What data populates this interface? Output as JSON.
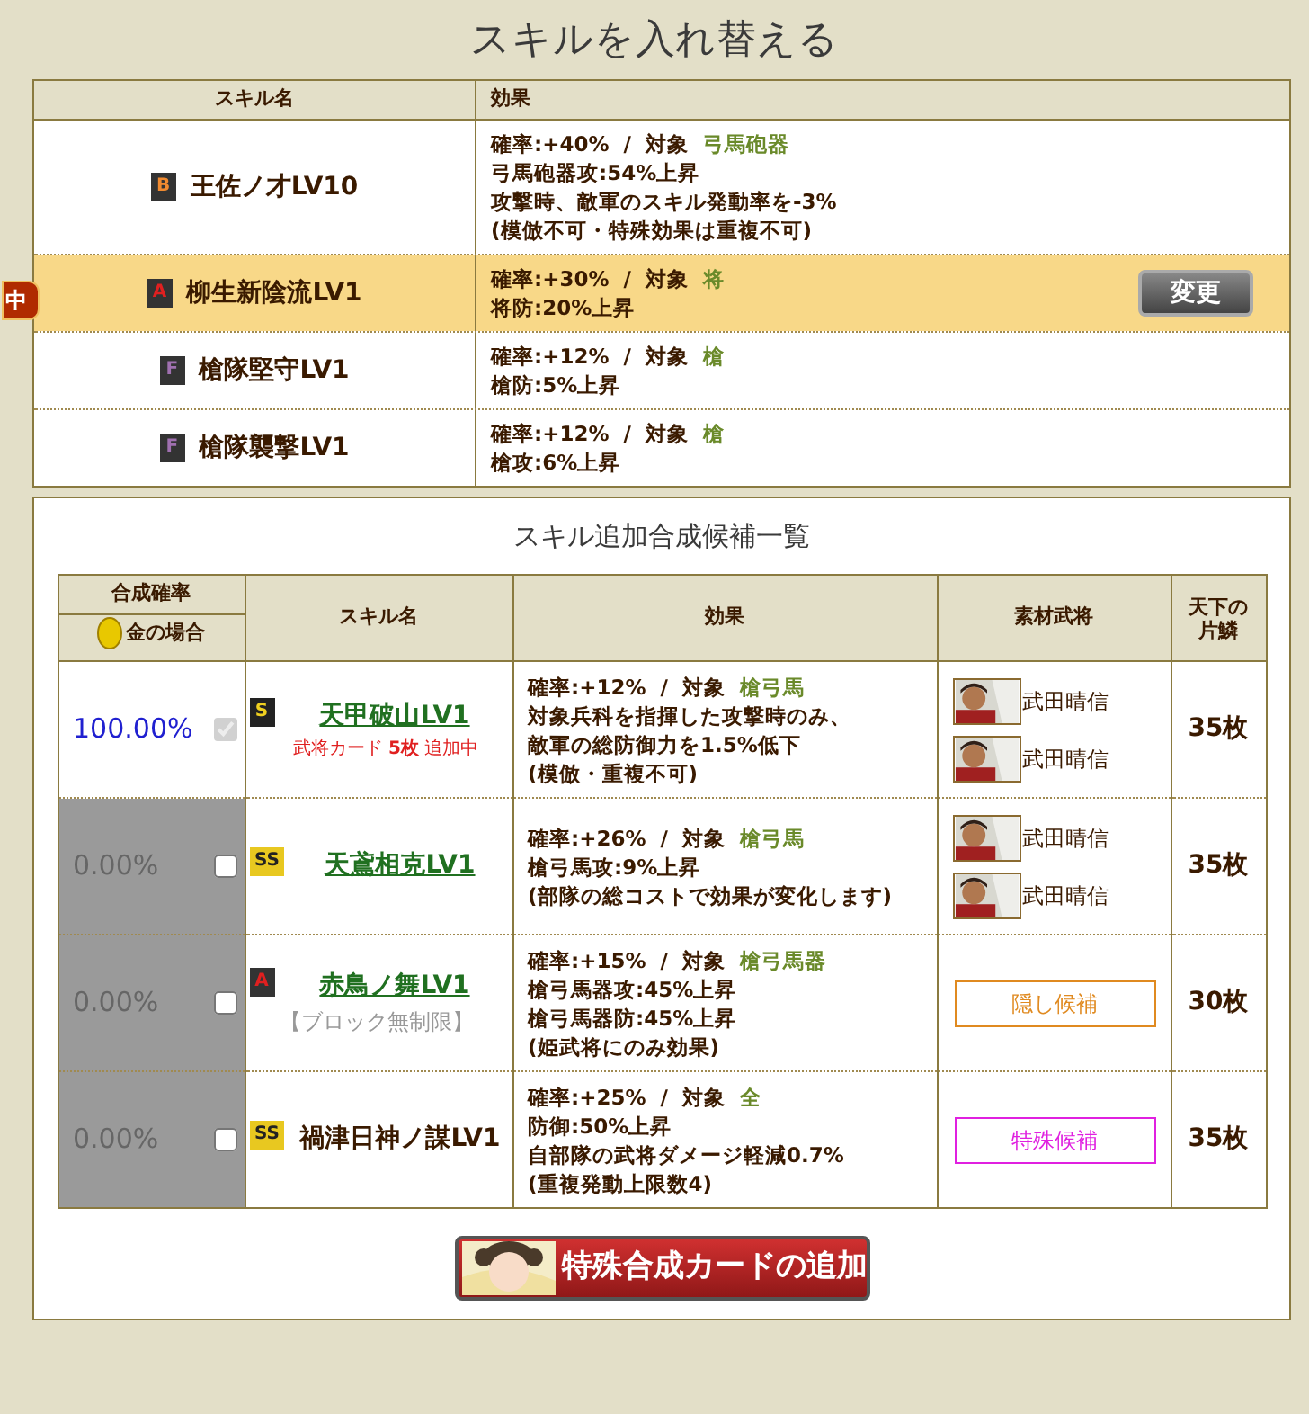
{
  "title": "スキルを入れ替える",
  "current": {
    "columns": [
      "スキル名",
      "効果"
    ],
    "tag": "中",
    "change_button": "変更",
    "rows": [
      {
        "rank": "B",
        "name": "王佐ノ才LV10",
        "selected": false,
        "rate": "確率:+40%  /  対象",
        "target": "弓馬砲器",
        "lines": [
          "弓馬砲器攻:54%上昇",
          "攻撃時、敵軍のスキル発動率を-3%",
          "(模倣不可・特殊効果は重複不可)"
        ]
      },
      {
        "rank": "A",
        "name": "柳生新陰流LV1",
        "selected": true,
        "rate": "確率:+30%  /  対象",
        "target": "将",
        "lines": [
          "将防:20%上昇"
        ]
      },
      {
        "rank": "F",
        "name": "槍隊堅守LV1",
        "selected": false,
        "rate": "確率:+12%  /  対象",
        "target": "槍",
        "lines": [
          "槍防:5%上昇"
        ]
      },
      {
        "rank": "F",
        "name": "槍隊襲撃LV1",
        "selected": false,
        "rate": "確率:+12%  /  対象",
        "target": "槍",
        "lines": [
          "槍攻:6%上昇"
        ]
      }
    ]
  },
  "candidates": {
    "title": "スキル追加合成候補一覧",
    "columns": [
      "合成確率",
      "金の場合",
      "スキル名",
      "効果",
      "素材武将",
      "天下の片鱗"
    ],
    "rows": [
      {
        "probability": "100.00%",
        "checked": true,
        "disabled": true,
        "rank": "S",
        "name": "天甲破山LV1",
        "link": true,
        "note": {
          "kind": "added",
          "text": "武将カード **5枚** 追加中"
        },
        "rate": "確率:+12%  /  対象",
        "target": "槍弓馬",
        "lines": [
          "対象兵科を指揮した攻撃時のみ、",
          "敵軍の総防御力を1.5%低下",
          "(模倣・重複不可)"
        ],
        "materials": {
          "kind": "generals",
          "names": [
            "武田晴信",
            "武田晴信"
          ]
        },
        "pieces": "35枚"
      },
      {
        "probability": "0.00%",
        "checked": false,
        "disabled": false,
        "rank": "SS",
        "name": "天鳶相克LV1",
        "link": true,
        "rate": "確率:+26%  /  対象",
        "target": "槍弓馬",
        "lines": [
          "槍弓馬攻:9%上昇",
          "(部隊の総コストで効果が変化します)"
        ],
        "materials": {
          "kind": "generals",
          "names": [
            "武田晴信",
            "武田晴信"
          ]
        },
        "pieces": "35枚"
      },
      {
        "probability": "0.00%",
        "checked": false,
        "disabled": false,
        "rank": "A",
        "name": "赤鳥ノ舞LV1",
        "link": true,
        "note": {
          "kind": "block",
          "text": "【ブロック無制限】"
        },
        "rate": "確率:+15%  /  対象",
        "target": "槍弓馬器",
        "lines": [
          "槍弓馬器攻:45%上昇",
          "槍弓馬器防:45%上昇",
          "(姫武将にのみ効果)"
        ],
        "materials": {
          "kind": "candidate",
          "label": "隠し候補",
          "color": "#e08a20"
        },
        "pieces": "30枚"
      },
      {
        "probability": "0.00%",
        "checked": false,
        "disabled": false,
        "rank": "SS",
        "name": "禍津日神ノ謀LV1",
        "link": false,
        "rate": "確率:+25%  /  対象",
        "target": "全",
        "lines": [
          "防御:50%上昇",
          "自部隊の武将ダメージ軽減0.7%",
          "(重複発動上限数4)"
        ],
        "materials": {
          "kind": "candidate",
          "label": "特殊候補",
          "color": "#e020e0"
        },
        "pieces": "35枚"
      }
    ]
  },
  "add_button": "特殊合成カードの追加"
}
